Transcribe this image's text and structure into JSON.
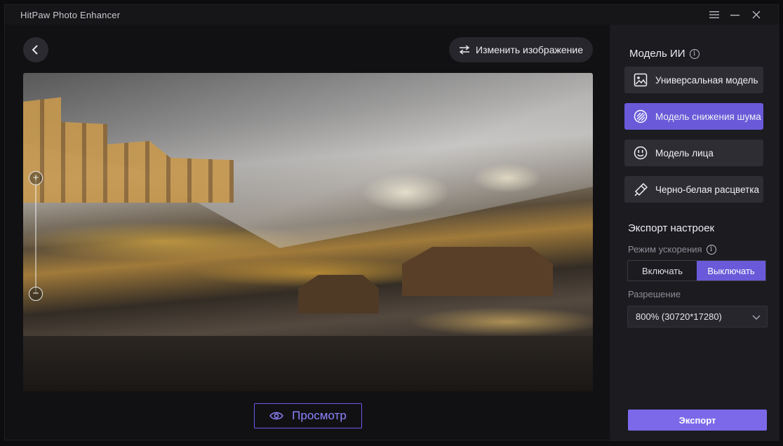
{
  "window": {
    "title": "HitPaw Photo Enhancer"
  },
  "toolbar": {
    "change_image_label": "Изменить изображение"
  },
  "preview": {
    "label": "Просмотр"
  },
  "zoom": {
    "plus": "+",
    "minus": "−"
  },
  "panel": {
    "ai_model_title": "Модель ИИ",
    "models": [
      {
        "label": "Универсальная модель",
        "icon": "image-icon",
        "active": false
      },
      {
        "label": "Модель снижения шума",
        "icon": "denoise-icon",
        "active": true
      },
      {
        "label": "Модель лица",
        "icon": "face-icon",
        "active": false
      },
      {
        "label": "Черно-белая расцветка",
        "icon": "colorize-icon",
        "active": false
      }
    ],
    "export_settings_title": "Экспорт настроек",
    "acceleration_label": "Режим ускорения",
    "acceleration_options": {
      "on": "Включать",
      "off": "Выключать",
      "selected": "off"
    },
    "resolution_label": "Разрешение",
    "resolution_value": "800% (30720*17280)",
    "export_label": "Экспорт"
  },
  "colors": {
    "accent": "#6a5ad9",
    "export": "#7c69ea",
    "panel": "#1b1b20",
    "background": "#111114"
  }
}
